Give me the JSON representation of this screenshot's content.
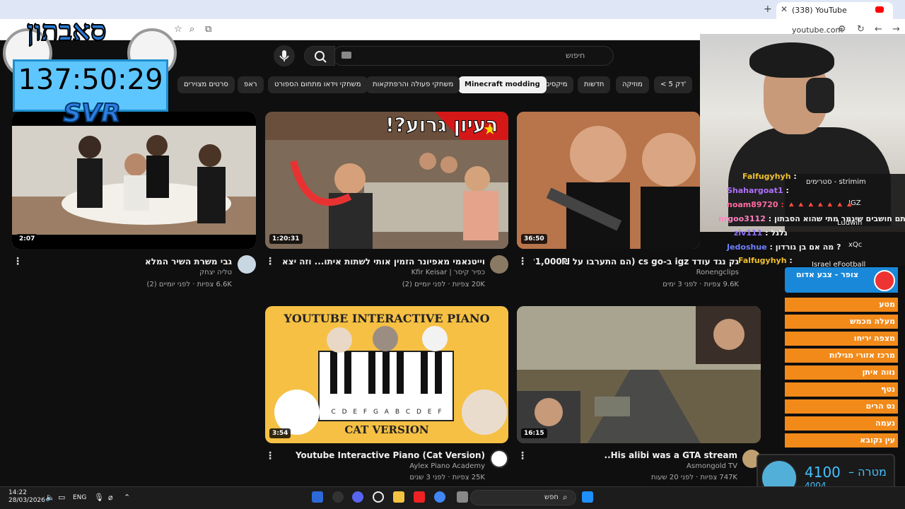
{
  "browser": {
    "tab_title": "(338) YouTube",
    "url": "youtube.com"
  },
  "youtube": {
    "search_placeholder": "חיפוש",
    "chips": [
      {
        "label": "< 5 דק'"
      },
      {
        "label": "מוזיקה"
      },
      {
        "label": "חדשות"
      },
      {
        "label": "מיקסים"
      },
      {
        "label": "Minecraft modding"
      },
      {
        "label": "משחקי פעולה והרפתקאות"
      },
      {
        "label": "משחקי וידאו מתחום הספורט"
      },
      {
        "label": "ראפ"
      },
      {
        "label": "סרטים מצוירים"
      }
    ],
    "videos": [
      {
        "title": "גבי משרת השיר המלא",
        "channel": "טליה יצחק",
        "meta": "6.6K צפיות · לפני יומיים (2)",
        "duration": "2:07"
      },
      {
        "title": "וייטנאמי מאפיונר הזמין אותי לשתות איתו... וזה יצא משליטה ₪",
        "channel": "כפיר קיסר | Kfir Keisar",
        "meta": "20K צפיות · לפני יומיים (2)",
        "duration": "1:20:31"
      },
      {
        "title": "גק נגד עודד igz ב-cs go (הם התערבו על 1,000₪?!)",
        "channel": "Ronengclips",
        "meta": "9.6K צפיות · לפני 3 ימים",
        "duration": "36:50"
      },
      {
        "title": "Youtube Interactive Piano (Cat Version)",
        "channel": "Aylex Piano Academy",
        "meta": "25K צפיות · לפני 3 שנים",
        "duration": "3:54"
      },
      {
        "title": "His alibi was a GTA stream..",
        "channel": "Asmongold TV",
        "meta": "747K צפיות · לפני 20 שעות",
        "duration": "16:15"
      }
    ],
    "thumb_texts": {
      "idea": "רעיון גרוע?!",
      "piano_title": "YOUTUBE INTERACTIVE PIANO",
      "piano_keys": "C D E F G A B C D E F",
      "piano_sub": "CAT VERSION"
    }
  },
  "overlay": {
    "logo": "סאבתון",
    "timer": "137:50:29",
    "svr": "SVR",
    "chat": [
      {
        "user": "Falfugyhyh",
        "msg": ":",
        "color": "#f0c030"
      },
      {
        "user": "Shahargoat1",
        "msg": ":",
        "color": "#b070ff"
      },
      {
        "user": "noam89720",
        "msg": ": 🔺🔺🔺🔺🔺🔺🔺",
        "color": "#ff6aa0"
      },
      {
        "user": "nrgoo3112",
        "msg": ": אתם חושבים שיגמר מתי שהוא הסבתון",
        "color": "#ff80c0"
      },
      {
        "user": "ziv111",
        "msg": ": גלגל",
        "color": "#9070ff"
      },
      {
        "user": "Jedoshue",
        "msg": ": מה אם בן גורדון ?",
        "color": "#7080ff"
      },
      {
        "user": "Falfugyhyh",
        "msg": ":",
        "color": "#f0c030"
      }
    ],
    "side_list": [
      "סטרימים - strimim",
      "IGZ",
      "Ludwin",
      "xQc",
      "Israel eFootball"
    ],
    "rank_header": "צופר - צבע אדום",
    "ranks": [
      "מטע",
      "מעלה מכמש",
      "מצפה יריחו",
      "מרכז אזורי מגילות",
      "נווה איתן",
      "נטף",
      "נס הרים",
      "נעמה",
      "עין נקובא"
    ],
    "goal_label": "מטרה –",
    "goal_value": "4100",
    "goal_current": "4004"
  },
  "taskbar": {
    "time": "14:22",
    "date": "28/03/2026",
    "lang": "ENG",
    "search": "חפש"
  }
}
